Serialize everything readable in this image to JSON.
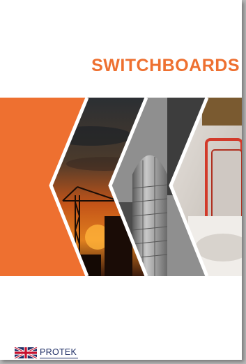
{
  "cover": {
    "title": "SWITCHBOARDS",
    "brand_name": "PROTEK",
    "flag_icon": "uk-flag-icon",
    "accent_color": "#ee7030",
    "brand_color": "#1f2f66"
  },
  "photos": [
    "construction-crane-sunset-photo",
    "glass-skyscraper-photo",
    "switchboard-interior-photo"
  ]
}
